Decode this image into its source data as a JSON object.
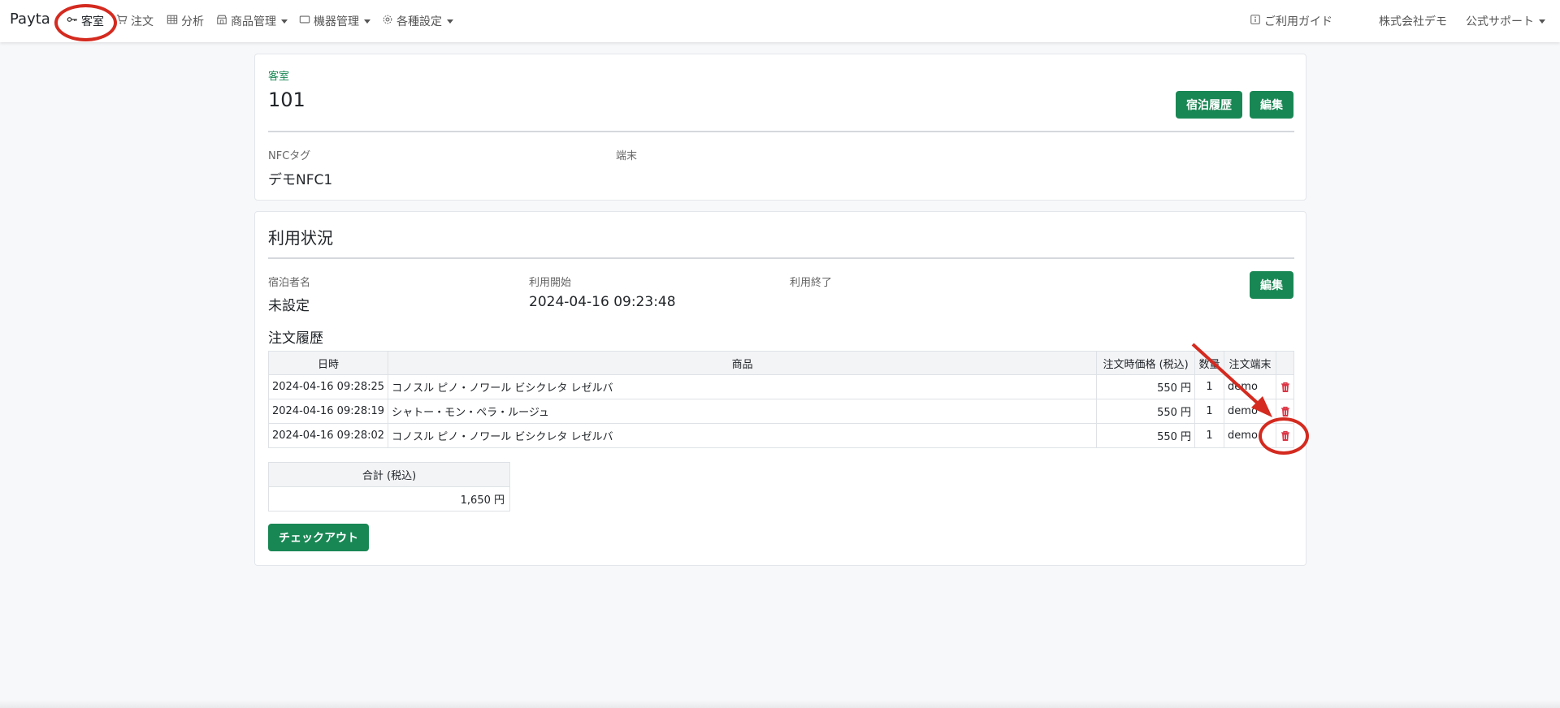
{
  "navbar": {
    "brand": "Payta",
    "items": [
      {
        "label": "客室",
        "icon": "key-icon"
      },
      {
        "label": "注文",
        "icon": "cart-icon"
      },
      {
        "label": "分析",
        "icon": "table-icon"
      },
      {
        "label": "商品管理",
        "icon": "shop-icon"
      },
      {
        "label": "機器管理",
        "icon": "device-icon"
      },
      {
        "label": "各種設定",
        "icon": "gear-icon"
      }
    ],
    "guide": "ご利用ガイド",
    "company": "株式会社デモ",
    "support": "公式サポート"
  },
  "room": {
    "section_label": "客室",
    "number": "101",
    "history_button": "宿泊履歴",
    "edit_button": "編集",
    "nfc_label": "NFCタグ",
    "nfc_value": "デモNFC1",
    "terminal_label": "端末"
  },
  "usage": {
    "title": "利用状況",
    "guest_label": "宿泊者名",
    "guest_value": "未設定",
    "start_label": "利用開始",
    "start_value": "2024-04-16 09:23:48",
    "end_label": "利用終了",
    "edit_button": "編集",
    "order_history_title": "注文履歴",
    "columns": [
      "日時",
      "商品",
      "注文時価格 (税込)",
      "数量",
      "注文端末"
    ],
    "orders": [
      {
        "datetime": "2024-04-16 09:28:25",
        "product": "コノスル ピノ・ノワール ビシクレタ レゼルバ",
        "price": "550 円",
        "qty": "1",
        "terminal": "demo"
      },
      {
        "datetime": "2024-04-16 09:28:19",
        "product": "シャトー・モン・ペラ・ルージュ",
        "price": "550 円",
        "qty": "1",
        "terminal": "demo"
      },
      {
        "datetime": "2024-04-16 09:28:02",
        "product": "コノスル ピノ・ノワール ビシクレタ レゼルバ",
        "price": "550 円",
        "qty": "1",
        "terminal": "demo"
      }
    ],
    "total_label": "合計 (税込)",
    "total_value": "1,650 円",
    "checkout_button": "チェックアウト"
  },
  "colors": {
    "accent": "#198754",
    "danger": "#dc3545",
    "annotation": "#d42a1f"
  }
}
